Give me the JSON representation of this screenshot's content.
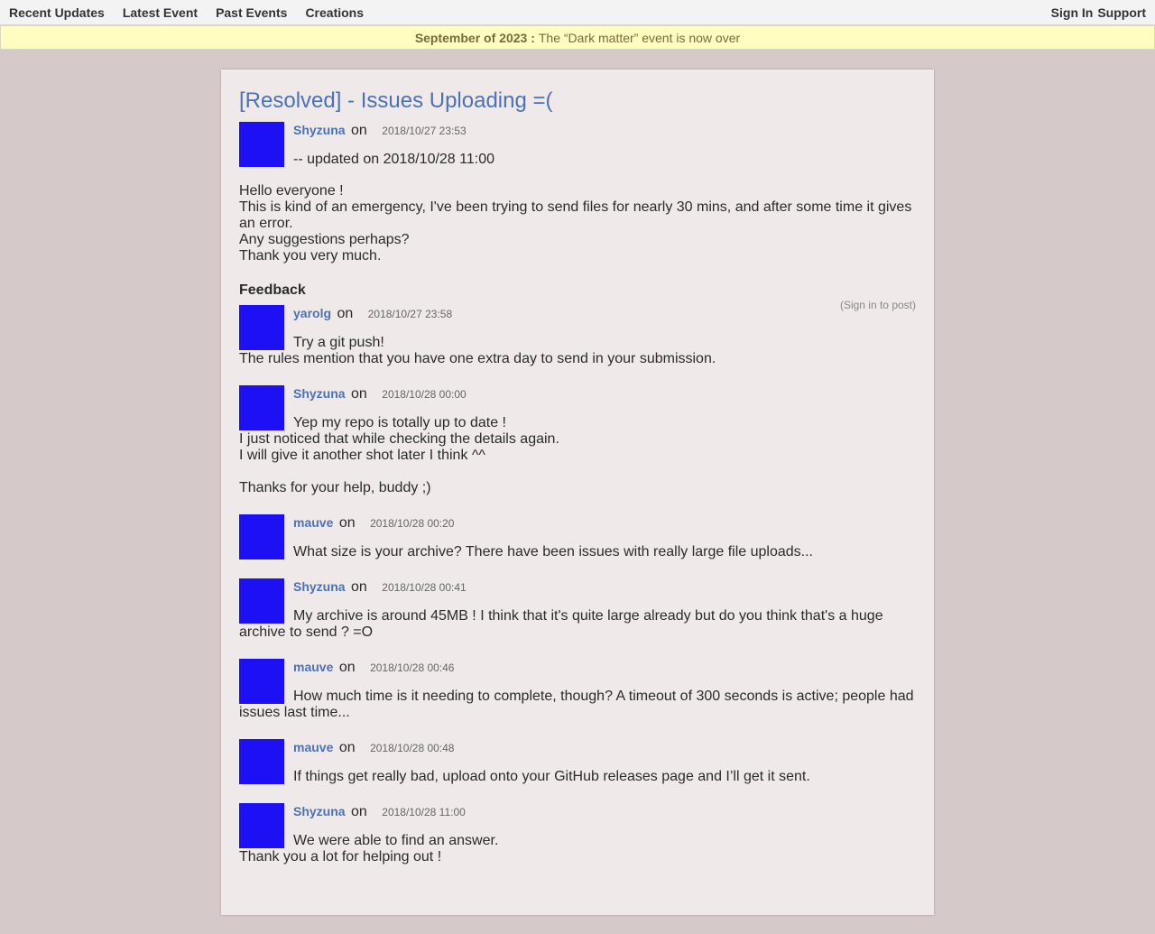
{
  "nav": {
    "left": [
      "Recent Updates",
      "Latest Event",
      "Past Events",
      "Creations"
    ],
    "signin": "Sign In",
    "support": "Support"
  },
  "banner": {
    "date": "September of 2023 :",
    "text": "The “Dark matter” event is now over"
  },
  "post": {
    "title": "[Resolved] - Issues Uploading =(",
    "author": "Shyzuna",
    "on": "on",
    "timestamp": "2018/10/27 23:53",
    "updated": "-- updated on 2018/10/28 11:00",
    "body": [
      "Hello everyone !",
      "This is kind of an emergency, I've been trying to send files for nearly 30 mins, and after some time it gives an error.",
      "Any suggestions perhaps?",
      "Thank you very much."
    ]
  },
  "feedback": {
    "heading": "Feedback",
    "signin_note": "(Sign in to post)",
    "comments": [
      {
        "author": "yarolg",
        "on": "on",
        "timestamp": "2018/10/27 23:58",
        "lines": [
          "Try a git push!",
          "The rules mention that you have one extra day to send in your submission."
        ]
      },
      {
        "author": "Shyzuna",
        "on": "on",
        "timestamp": "2018/10/28 00:00",
        "lines": [
          "Yep my repo is totally up to date !",
          "I just noticed that while checking the details again.",
          "I will give it another shot later I think ^^",
          "",
          "Thanks for your help, buddy ;)"
        ]
      },
      {
        "author": "mauve",
        "on": "on",
        "timestamp": "2018/10/28 00:20",
        "lines": [
          "What size is your archive? There have been issues with really large file uploads..."
        ]
      },
      {
        "author": "Shyzuna",
        "on": "on",
        "timestamp": "2018/10/28 00:41",
        "lines": [
          "My archive is around 45MB ! I think that it's quite large already but do you think that's a huge archive to send ? =O"
        ]
      },
      {
        "author": "mauve",
        "on": "on",
        "timestamp": "2018/10/28 00:46",
        "lines": [
          "How much time is it needing to complete, though? A timeout of 300 seconds is active; people had issues last time..."
        ]
      },
      {
        "author": "mauve",
        "on": "on",
        "timestamp": "2018/10/28 00:48",
        "lines": [
          "If things get really bad, upload onto your GitHub releases page and I’ll get it sent."
        ]
      },
      {
        "author": "Shyzuna",
        "on": "on",
        "timestamp": "2018/10/28 11:00",
        "lines": [
          "We were able to find an answer.",
          "Thank you a lot for helping out !"
        ]
      }
    ]
  },
  "colors": {
    "background": "#d6c9c9",
    "card": "#f0e9e9",
    "link": "#4a72b5",
    "avatar": "#1d10f5",
    "banner": "#fffdc0"
  }
}
